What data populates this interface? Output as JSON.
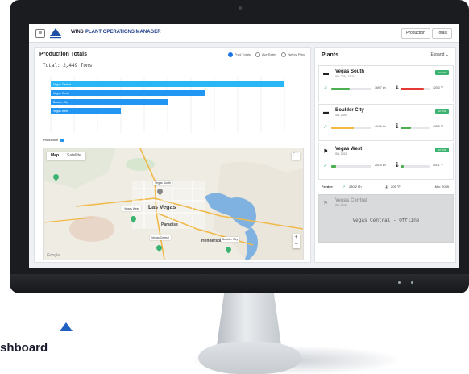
{
  "app": {
    "brand": "WNG",
    "name": "WINS",
    "subtitle": "PLANT OPERATIONS MANAGER",
    "tabs": [
      "Production",
      "Totals"
    ],
    "menu_icon": "menu-icon"
  },
  "production": {
    "title": "Production Totals",
    "filters": [
      "Prod Totals",
      "Ave Rates",
      "Net by Plant"
    ],
    "total_label": "Total: 2,449 Tons",
    "legend": "Production",
    "bar_color": "#2196f3",
    "bars": [
      {
        "label": "Vegas Central",
        "value": 1.0
      },
      {
        "label": "Vegas South",
        "value": 0.66
      },
      {
        "label": "Boulder City",
        "value": 0.5
      },
      {
        "label": "Vegas West",
        "value": 0.3
      }
    ]
  },
  "map": {
    "tabs": [
      "Map",
      "Satellite"
    ],
    "cities": [
      "Las Vegas",
      "Paradise",
      "Henderson"
    ],
    "tags": [
      "Vegas South",
      "Vegas West",
      "Boulder City",
      "Vegas Central"
    ],
    "footer": "Google"
  },
  "plants_panel": {
    "title": "Plants",
    "expand_label": "Expand",
    "plants": [
      {
        "name": "Vegas South",
        "sub": "SN: 226 113 11",
        "badge": "ACTIVE",
        "val1": "369.7 t/h",
        "val2": "420.3 °F",
        "fill1": 0.45,
        "fill2": 0.8,
        "color1": "#4caf50",
        "color2": "#e53935"
      },
      {
        "name": "Boulder City",
        "sub": "SN: 2493",
        "badge": "ACTIVE",
        "val1": "404.6 t/h",
        "val2": "405.5 °F",
        "fill1": 0.55,
        "fill2": 0.35,
        "color1": "#f5b942",
        "color2": "#4caf50"
      },
      {
        "name": "Vegas West",
        "sub": "SN: 2024",
        "badge": "ACTIVE",
        "val1": "201.4 t/h",
        "val2": "401.1 °F",
        "fill1": 0.12,
        "fill2": 0.1,
        "color1": "#4caf50",
        "color2": "#4caf50"
      }
    ],
    "feeder": {
      "label": "Feeder:",
      "v1": "230.2 t/h",
      "v2": "205 °F",
      "v3": "Mix: 2039"
    },
    "offline": {
      "name": "Vegas Central",
      "sub": "SN: 1020",
      "message": "Vegas Central - Offline"
    }
  },
  "caption": {
    "text": "shboard"
  }
}
